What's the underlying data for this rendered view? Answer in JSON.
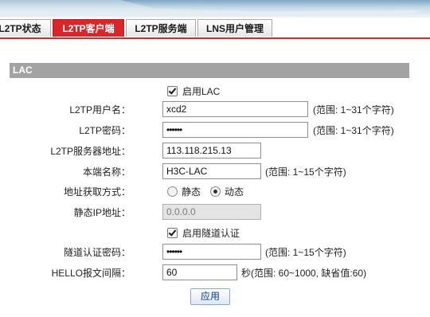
{
  "tabs": [
    {
      "label": "L2TP状态",
      "active": false
    },
    {
      "label": "L2TP客户端",
      "active": true
    },
    {
      "label": "L2TP服务端",
      "active": false
    },
    {
      "label": "LNS用户管理",
      "active": false
    }
  ],
  "section": {
    "title": "LAC"
  },
  "form": {
    "enable_lac": {
      "label": "启用LAC",
      "checked": true
    },
    "username": {
      "label": "L2TP用户名：",
      "value": "xcd2",
      "hint": "(范围: 1~31个字符)"
    },
    "password": {
      "label": "L2TP密码：",
      "value": "••••••",
      "hint": "(范围: 1~31个字符)"
    },
    "server_addr": {
      "label": "L2TP服务器地址：",
      "value": "113.118.215.13"
    },
    "local_name": {
      "label": "本端名称：",
      "value": "H3C-LAC",
      "hint": "(范围: 1~15个字符)"
    },
    "addr_mode": {
      "label": "地址获取方式：",
      "option_static": "静态",
      "option_dynamic": "动态",
      "selected": "动态"
    },
    "static_ip": {
      "label": "静态IP地址：",
      "value": "0.0.0.0"
    },
    "enable_tunnel_auth": {
      "label": "启用隧道认证",
      "checked": true
    },
    "tunnel_password": {
      "label": "隧道认证密码：",
      "value": "••••••",
      "hint": "(范围: 1~15个字符)"
    },
    "hello_interval": {
      "label": "HELLO报文间隔：",
      "value": "60",
      "hint": "秒(范围: 60~1000, 缺省值:60)"
    }
  },
  "apply_button": "应用",
  "colors": {
    "accent": "#d8262b",
    "section_header": "#a3a3a3",
    "button_text": "#0a3a8a"
  }
}
